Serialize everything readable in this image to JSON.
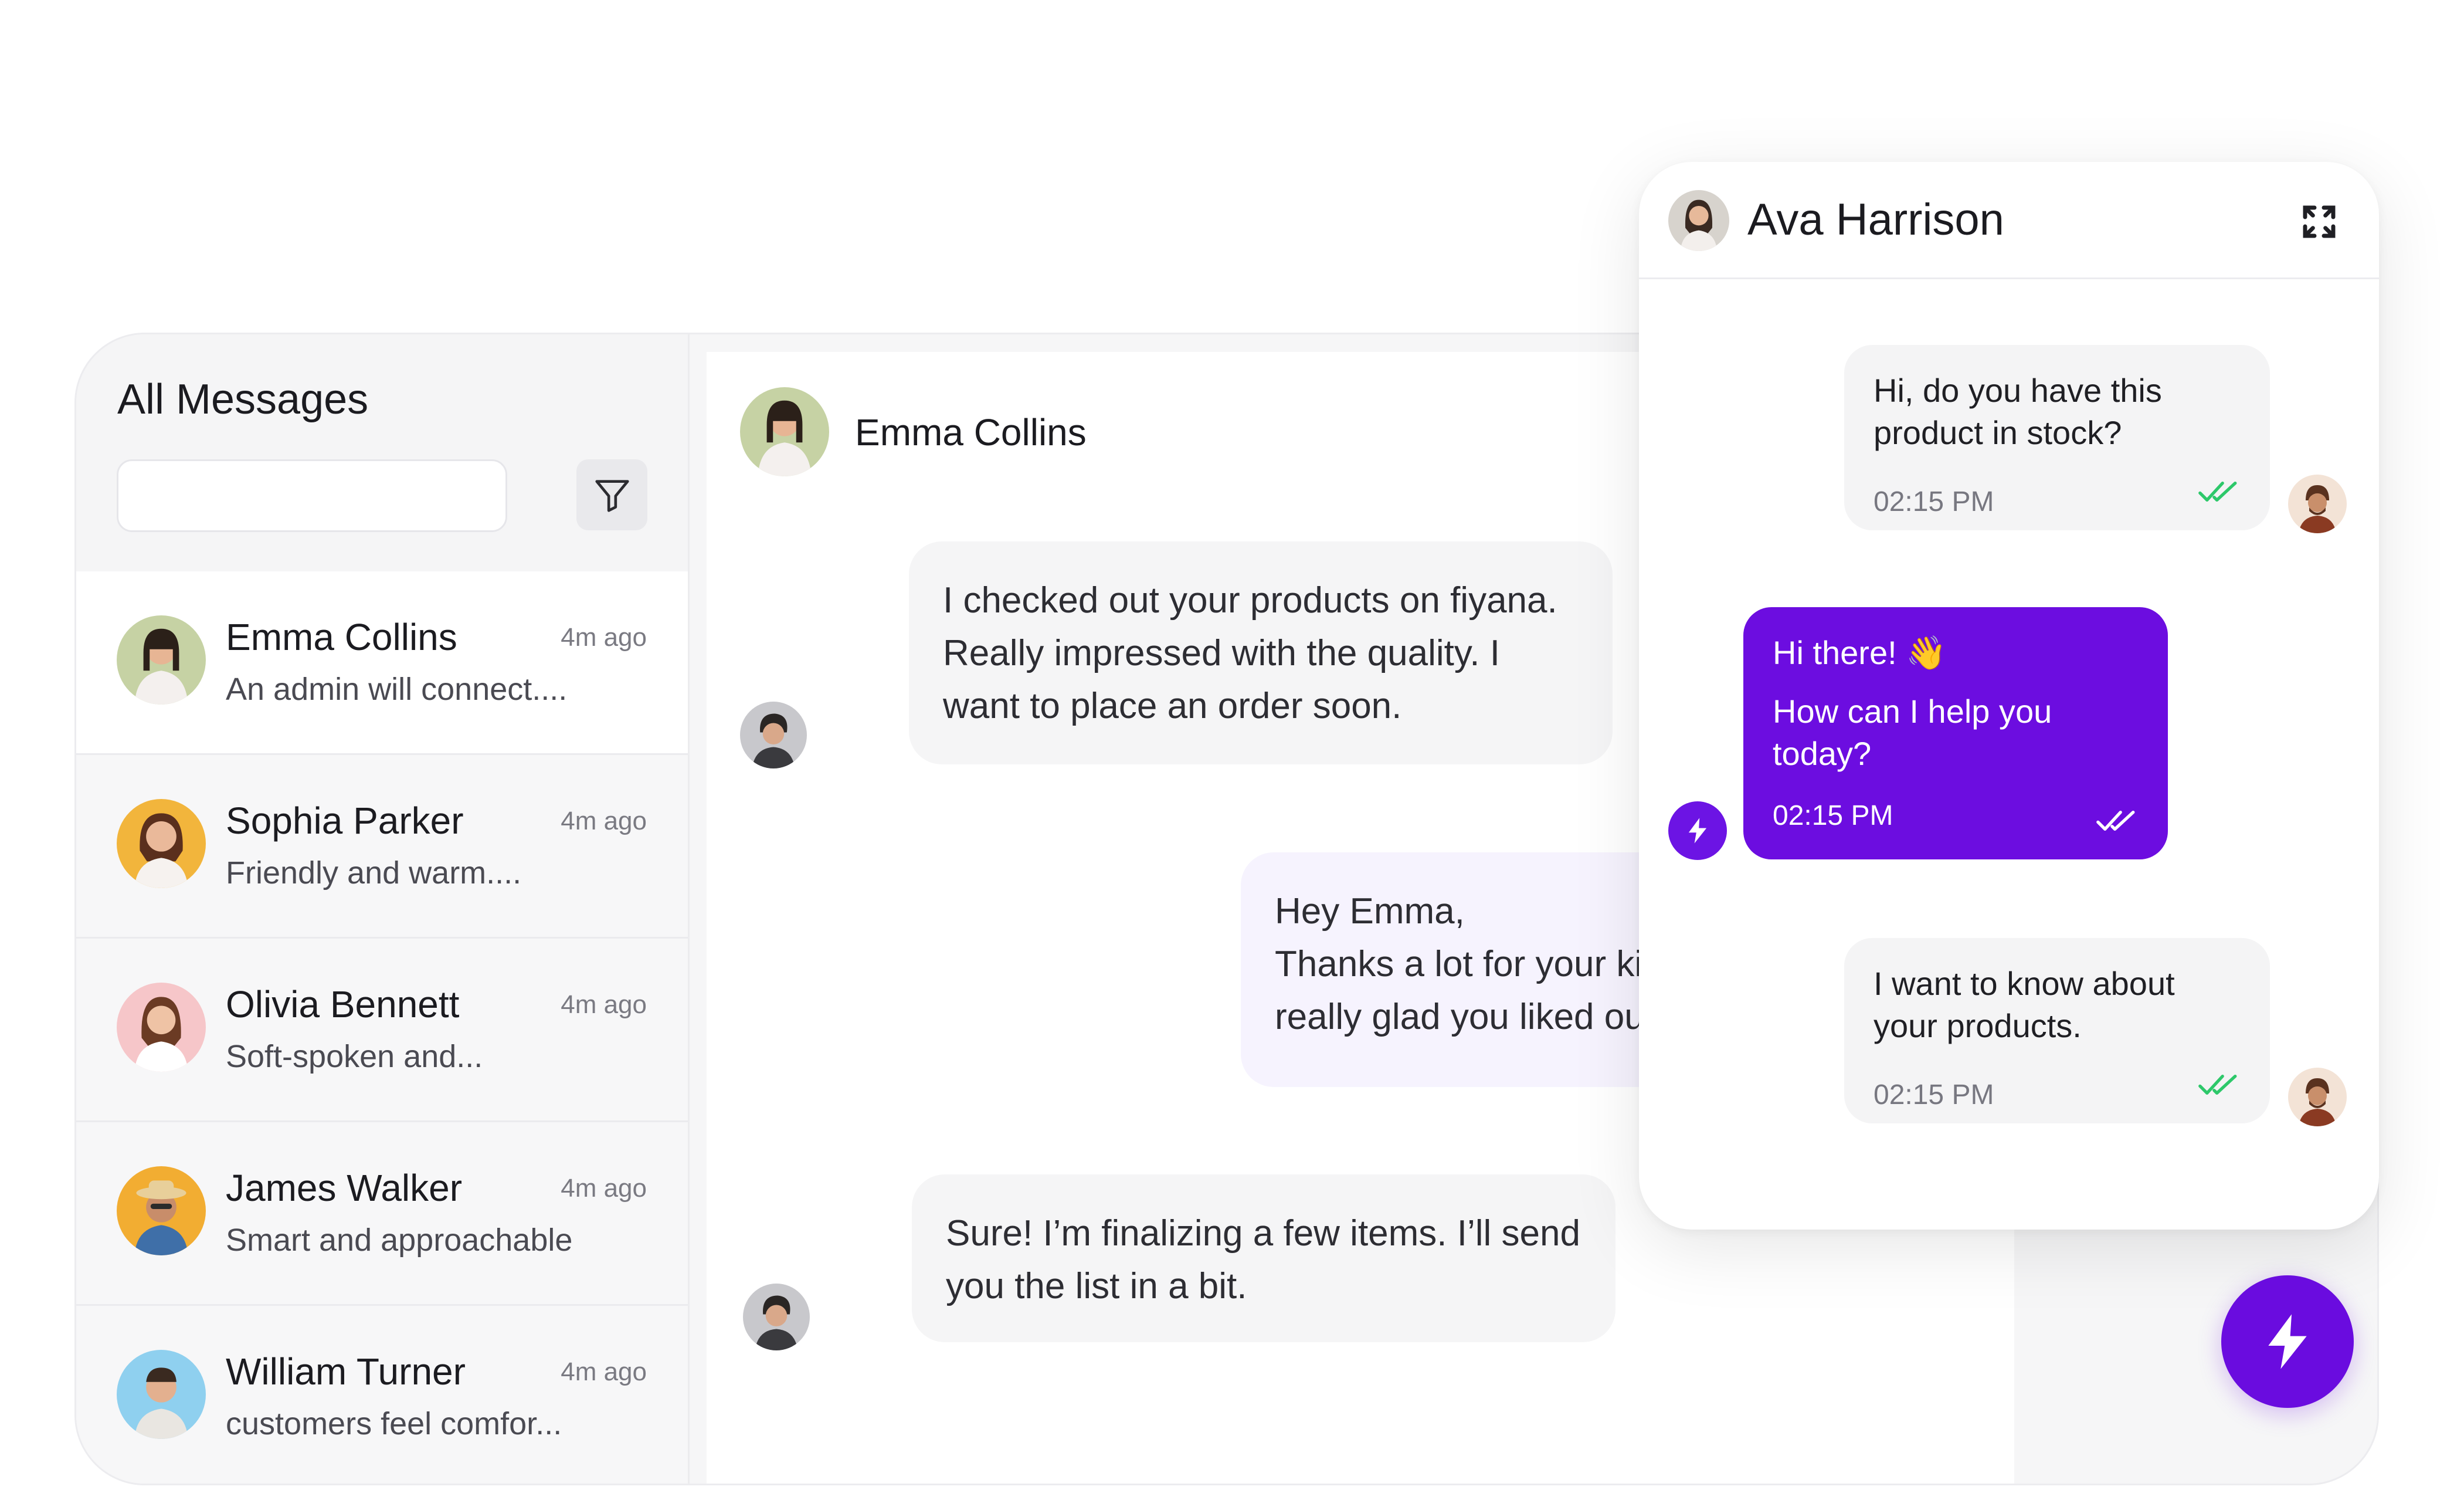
{
  "sidebar": {
    "title": "All Messages",
    "search_placeholder": "",
    "contacts": [
      {
        "name": "Emma Collins",
        "time": "4m ago",
        "preview": "An admin will connect....",
        "active": true
      },
      {
        "name": "Sophia Parker",
        "time": "4m ago",
        "preview": "Friendly and warm...."
      },
      {
        "name": "Olivia Bennett",
        "time": "4m ago",
        "preview": "Soft-spoken and..."
      },
      {
        "name": "James Walker",
        "time": "4m ago",
        "preview": "Smart and approachable"
      },
      {
        "name": "William Turner",
        "time": "4m ago",
        "preview": "customers feel comfor..."
      }
    ]
  },
  "chat": {
    "contact_name": "Emma Collins",
    "messages": [
      {
        "direction": "in",
        "text": "I checked out your products on fiyana.\nReally impressed with the quality. I\nwant to place an order soon."
      },
      {
        "direction": "out",
        "text": "Hey Emma,\nThanks a lot for your kind\nreally glad you liked our pr"
      },
      {
        "direction": "in",
        "text": "Sure! I’m finalizing a few items. I’ll send\nyou the list in a bit."
      }
    ]
  },
  "widget": {
    "contact_name": "Ava Harrison",
    "messages": [
      {
        "from": "user",
        "line1": "Hi, do you have this",
        "line2": "product in stock?",
        "time": "02:15 PM"
      },
      {
        "from": "bot",
        "greeting": "Hi there! 👋",
        "line1": "How can I help you",
        "line2": "today?",
        "time": "02:15 PM"
      },
      {
        "from": "user",
        "line1": "I want to know about",
        "line2": "your products.",
        "time": "02:15 PM"
      }
    ]
  },
  "colors": {
    "accent": "#6c0de0",
    "read_check": "#2dc86a"
  }
}
